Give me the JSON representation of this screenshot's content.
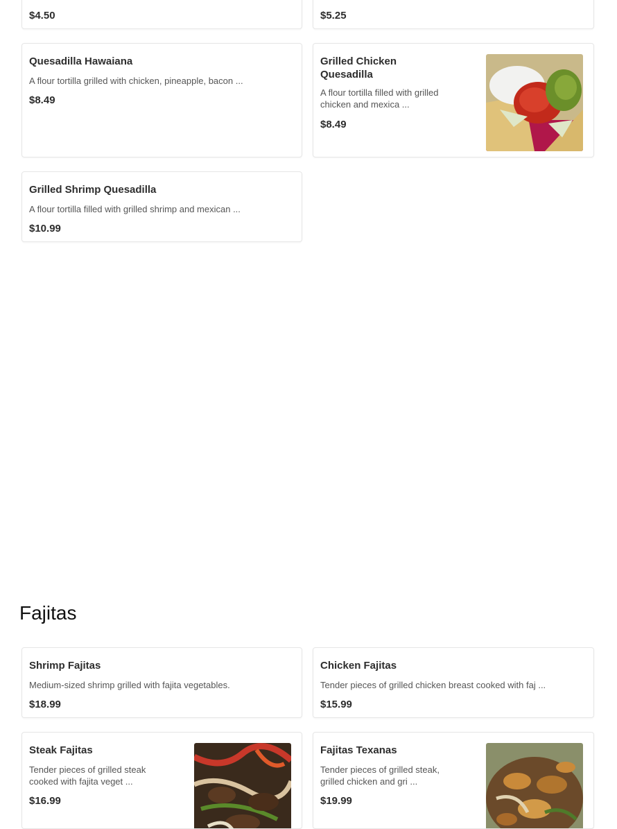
{
  "top_partial": {
    "left_price": "$4.50",
    "right_price": "$5.25"
  },
  "quesadillas": [
    {
      "name": "Quesadilla Hawaiana",
      "desc": "A flour tortilla grilled with chicken, pineapple, bacon ...",
      "price": "$8.49"
    },
    {
      "name": "Grilled Chicken Quesadilla",
      "desc": "A flour tortilla filled with grilled chicken and mexica ...",
      "price": "$8.49",
      "image": "quesadilla-photo"
    },
    {
      "name": "Grilled Shrimp Quesadilla",
      "desc": "A flour tortilla filled with grilled shrimp and mexican ...",
      "price": "$10.99"
    }
  ],
  "fajitas": {
    "title": "Fajitas",
    "items": [
      {
        "name": "Shrimp Fajitas",
        "desc": "Medium-sized shrimp grilled with fajita vegetables.",
        "price": "$18.99"
      },
      {
        "name": "Chicken Fajitas",
        "desc": "Tender pieces of grilled chicken breast cooked with faj ...",
        "price": "$15.99"
      },
      {
        "name": "Steak Fajitas",
        "desc": "Tender pieces of grilled steak cooked with fajita veget ...",
        "price": "$16.99",
        "image": "steak-fajitas-photo"
      },
      {
        "name": "Fajitas Texanas",
        "desc": "Tender pieces of grilled steak, grilled chicken and gri ...",
        "price": "$19.99",
        "image": "fajitas-texanas-photo"
      }
    ]
  }
}
